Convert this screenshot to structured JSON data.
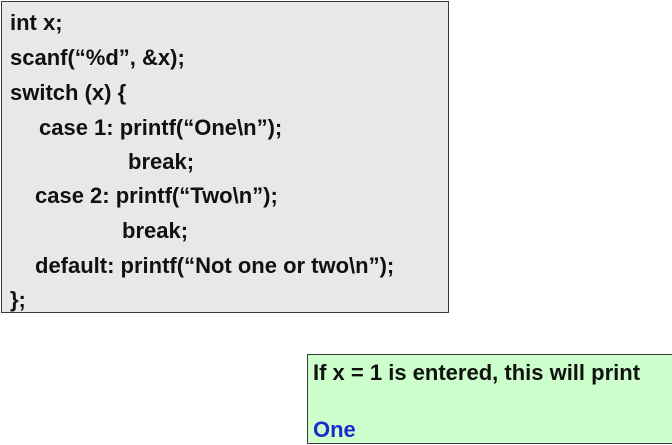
{
  "code": {
    "lines": [
      "int x;",
      "scanf(“%d”, &x);",
      "switch (x) {",
      "case 1: printf(“One\\n”);",
      "break;",
      "case 2: printf(“Two\\n”);",
      "break;",
      "default: printf(“Not one or two\\n”);",
      "};"
    ]
  },
  "note": {
    "caption": "If x = 1 is entered, this will print",
    "output": "One",
    "caption_color": "#111111",
    "output_color": "#1a2ccc"
  }
}
